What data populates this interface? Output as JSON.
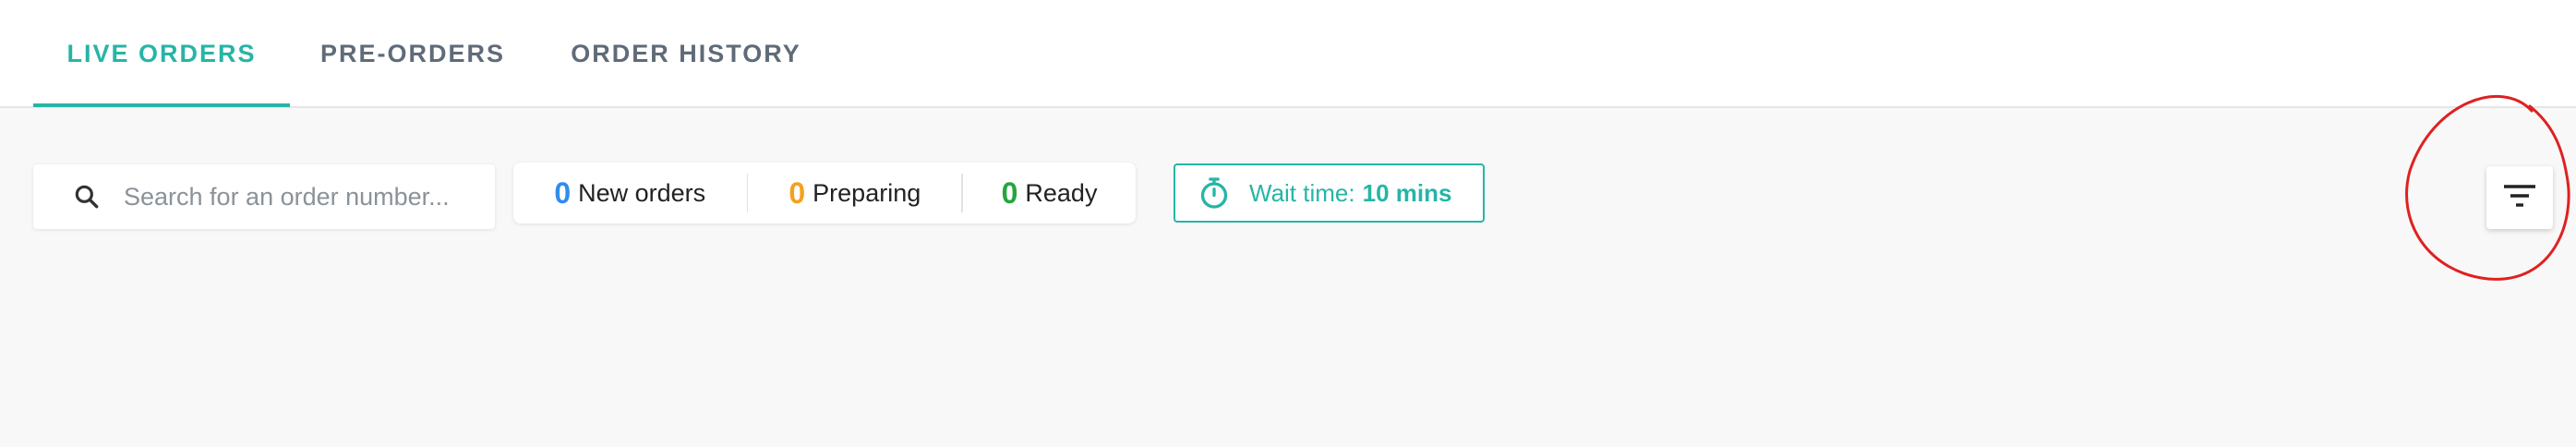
{
  "tabs": [
    {
      "label": "LIVE ORDERS",
      "active": true
    },
    {
      "label": "PRE-ORDERS",
      "active": false
    },
    {
      "label": "ORDER HISTORY",
      "active": false
    }
  ],
  "search": {
    "placeholder": "Search for an order number...",
    "icon": "search-icon"
  },
  "counts": {
    "new": {
      "value": "0",
      "label": "New orders",
      "color": "#2f8cf0"
    },
    "preparing": {
      "value": "0",
      "label": "Preparing",
      "color": "#f2a21e"
    },
    "ready": {
      "value": "0",
      "label": "Ready",
      "color": "#23a63b"
    }
  },
  "wait_time": {
    "label": "Wait time:",
    "value": "10 mins",
    "icon": "stopwatch-icon"
  },
  "filter_button": {
    "icon": "filter-icon"
  },
  "colors": {
    "accent": "#26b5a6",
    "annotation": "#e02020"
  }
}
